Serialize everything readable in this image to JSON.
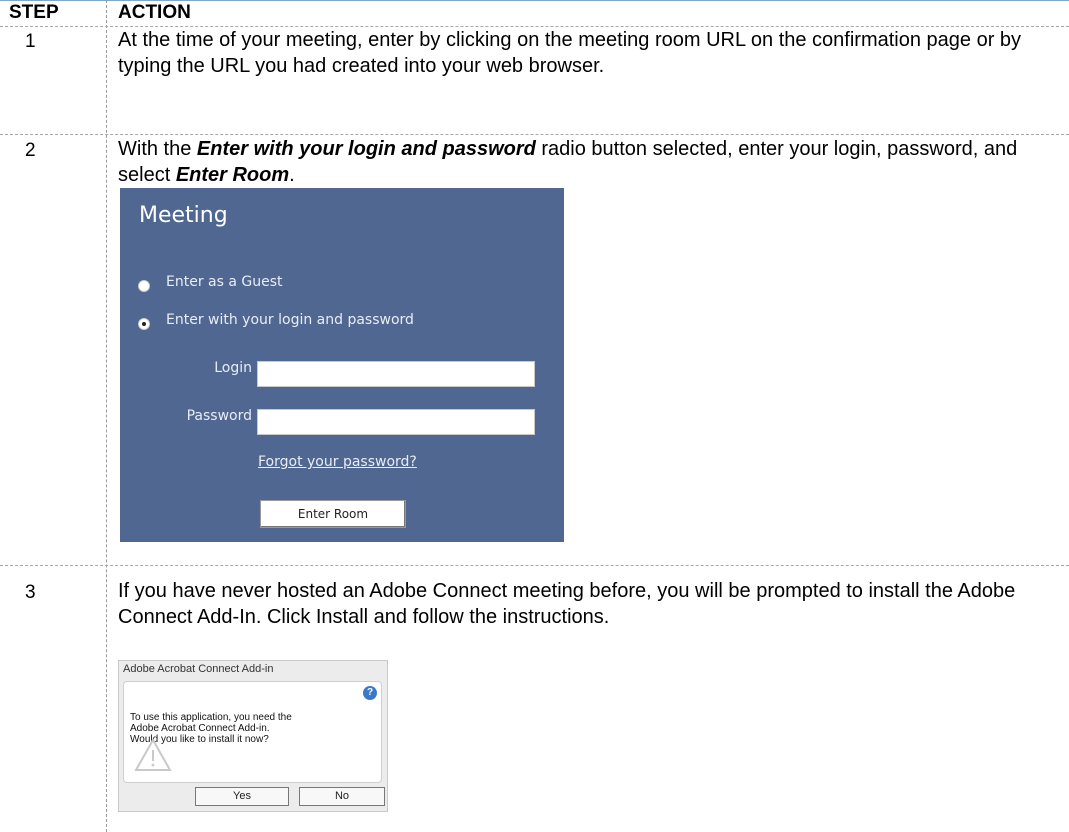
{
  "headers": {
    "step": "STEP",
    "action": "ACTION"
  },
  "rows": [
    {
      "step": "1",
      "text": "At the time of your meeting, enter by clicking on the meeting room URL on the confirmation page or by typing the URL you had created into your web browser."
    },
    {
      "step": "2",
      "pre": "With the ",
      "em1": "Enter with your login and password",
      "mid": " radio button selected, enter your login, password, and select ",
      "em2": "Enter Room",
      "post": "."
    },
    {
      "step": "3",
      "text": "If you have never hosted an Adobe Connect meeting before, you will be prompted to install the Adobe Connect Add-In. Click Install and follow the instructions."
    }
  ],
  "meeting_panel": {
    "title": "Meeting",
    "guest_option": "Enter as a Guest",
    "login_option": "Enter with your login and password",
    "login_label": "Login",
    "password_label": "Password",
    "login_value": "",
    "password_value": "",
    "forgot_link": "Forgot your password?",
    "enter_button": "Enter Room",
    "selected_option": "login"
  },
  "addin_dialog": {
    "title": "Adobe Acrobat Connect Add-in",
    "message": "To use this application, you need the Adobe Acrobat Connect Add-in. Would you like to install it now?",
    "yes_button": "Yes",
    "no_button": "No"
  },
  "colors": {
    "panel_bg": "#4f6791",
    "header_rule": "#7fa7c9"
  }
}
